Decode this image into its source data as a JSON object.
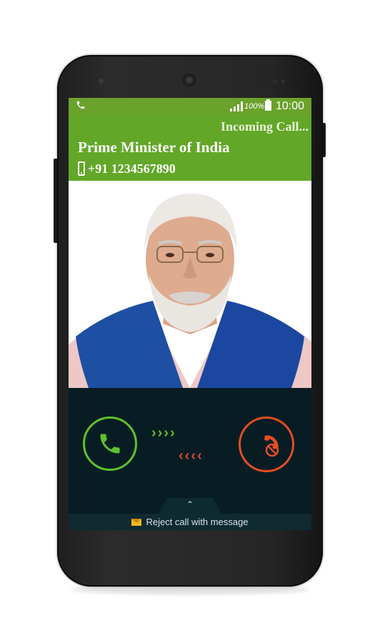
{
  "status_bar": {
    "battery_percent": "100%",
    "time": "10:00"
  },
  "call": {
    "state_label": "Incoming Call...",
    "caller_name": "Prime Minister of India",
    "caller_number": "+91 1234567890"
  },
  "actions": {
    "answer_icon": "phone-answer-icon",
    "reject_icon": "phone-reject-icon",
    "swipe_right_arrows": "›››› ",
    "swipe_left_arrows": "‹‹‹‹",
    "reject_with_message_label": "Reject call with message"
  },
  "colors": {
    "header_green": "#62a727",
    "answer_green": "#5ec12c",
    "reject_red": "#e64e22",
    "controls_bg": "#071d23"
  }
}
